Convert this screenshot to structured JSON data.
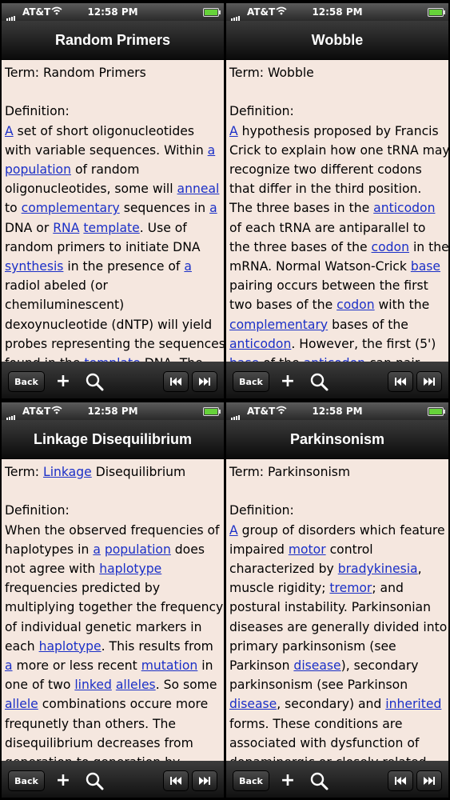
{
  "statusbar": {
    "carrier": "AT&T",
    "time": "12:58 PM"
  },
  "toolbar": {
    "back_label": "Back",
    "add_label": "+"
  },
  "colors": {
    "link": "#1a2fc7",
    "page_bg": "#f5e7df",
    "battery": "#66d23a"
  },
  "icons": [
    "signal-icon",
    "wifi-icon",
    "battery-icon",
    "plus-icon",
    "search-icon",
    "previous-icon",
    "next-icon"
  ],
  "panels": [
    {
      "title": "Random Primers",
      "lines": [
        [
          {
            "t": "Term: Random Primers"
          }
        ],
        [
          {
            "t": ""
          }
        ],
        [
          {
            "t": "Definition:"
          }
        ],
        [
          {
            "t": "A",
            "link": true
          },
          {
            "t": " set of short oligonucleotides"
          }
        ],
        [
          {
            "t": "with variable sequences. Within "
          },
          {
            "t": "a",
            "link": true
          }
        ],
        [
          {
            "t": "population",
            "link": true
          },
          {
            "t": " of random"
          }
        ],
        [
          {
            "t": "oligonucleotides, some will "
          },
          {
            "t": "anneal",
            "link": true
          }
        ],
        [
          {
            "t": "to "
          },
          {
            "t": "complementary",
            "link": true
          },
          {
            "t": " sequences in "
          },
          {
            "t": "a",
            "link": true
          }
        ],
        [
          {
            "t": "DNA or "
          },
          {
            "t": "RNA",
            "link": true
          },
          {
            "t": " "
          },
          {
            "t": "template",
            "link": true
          },
          {
            "t": ". Use of"
          }
        ],
        [
          {
            "t": "random primers to initiate DNA"
          }
        ],
        [
          {
            "t": "synthesis",
            "link": true
          },
          {
            "t": " in the presence of "
          },
          {
            "t": "a",
            "link": true
          }
        ],
        [
          {
            "t": "radiol abeled (or"
          }
        ],
        [
          {
            "t": "chemiluminescent)"
          }
        ],
        [
          {
            "t": "dexoynucleotide (dNTP) will yield"
          }
        ],
        [
          {
            "t": "probes representing the sequences"
          }
        ],
        [
          {
            "t": "found in the "
          },
          {
            "t": "template",
            "link": true
          },
          {
            "t": " DNA. The"
          }
        ]
      ]
    },
    {
      "title": "Wobble",
      "lines": [
        [
          {
            "t": "Term: Wobble"
          }
        ],
        [
          {
            "t": ""
          }
        ],
        [
          {
            "t": "Definition:"
          }
        ],
        [
          {
            "t": "A",
            "link": true
          },
          {
            "t": " hypothesis proposed by Francis"
          }
        ],
        [
          {
            "t": "Crick to explain how one tRNA may"
          }
        ],
        [
          {
            "t": "recognize two different codons"
          }
        ],
        [
          {
            "t": "that differ in the third position."
          }
        ],
        [
          {
            "t": "The three bases in the "
          },
          {
            "t": "anticodon",
            "link": true
          }
        ],
        [
          {
            "t": "of each tRNA are antiparallel to"
          }
        ],
        [
          {
            "t": "the three bases of the "
          },
          {
            "t": "codon",
            "link": true
          },
          {
            "t": " in the"
          }
        ],
        [
          {
            "t": "mRNA. Normal Watson-Crick "
          },
          {
            "t": "base",
            "link": true
          }
        ],
        [
          {
            "t": "pairing occurs between the first"
          }
        ],
        [
          {
            "t": "two bases of the "
          },
          {
            "t": "codon",
            "link": true
          },
          {
            "t": " with the"
          }
        ],
        [
          {
            "t": "complementary",
            "link": true
          },
          {
            "t": " bases of the"
          }
        ],
        [
          {
            "t": "anticodon",
            "link": true
          },
          {
            "t": ". However, the first (5')"
          }
        ],
        [
          {
            "t": "base",
            "link": true
          },
          {
            "t": " of the "
          },
          {
            "t": "anticodon",
            "link": true
          },
          {
            "t": " can pair"
          }
        ]
      ]
    },
    {
      "title": "Linkage Disequilibrium",
      "lines": [
        [
          {
            "t": "Term: "
          },
          {
            "t": "Linkage",
            "link": true
          },
          {
            "t": " Disequilibrium"
          }
        ],
        [
          {
            "t": ""
          }
        ],
        [
          {
            "t": "Definition:"
          }
        ],
        [
          {
            "t": "When the observed frequencies of"
          }
        ],
        [
          {
            "t": "haplotypes in "
          },
          {
            "t": "a",
            "link": true
          },
          {
            "t": " "
          },
          {
            "t": "population",
            "link": true
          },
          {
            "t": " does"
          }
        ],
        [
          {
            "t": "not agree with "
          },
          {
            "t": "haplotype",
            "link": true
          }
        ],
        [
          {
            "t": "frequencies predicted by"
          }
        ],
        [
          {
            "t": "multiplying together the frequency"
          }
        ],
        [
          {
            "t": "of individual genetic markers in"
          }
        ],
        [
          {
            "t": "each "
          },
          {
            "t": "haplotype",
            "link": true
          },
          {
            "t": ". This results from"
          }
        ],
        [
          {
            "t": "a",
            "link": true
          },
          {
            "t": " more or less recent "
          },
          {
            "t": "mutation",
            "link": true
          },
          {
            "t": " in"
          }
        ],
        [
          {
            "t": "one of two "
          },
          {
            "t": "linked",
            "link": true
          },
          {
            "t": " "
          },
          {
            "t": "alleles",
            "link": true
          },
          {
            "t": ". So some"
          }
        ],
        [
          {
            "t": "allele",
            "link": true
          },
          {
            "t": " combinations occure more"
          }
        ],
        [
          {
            "t": "frequnetly than others. The"
          }
        ],
        [
          {
            "t": "disequilibrium decreases from"
          }
        ],
        [
          {
            "t": "generation to generation by"
          }
        ]
      ]
    },
    {
      "title": "Parkinsonism",
      "lines": [
        [
          {
            "t": "Term: Parkinsonism"
          }
        ],
        [
          {
            "t": ""
          }
        ],
        [
          {
            "t": "Definition:"
          }
        ],
        [
          {
            "t": "A",
            "link": true
          },
          {
            "t": " group of disorders which feature"
          }
        ],
        [
          {
            "t": "impaired "
          },
          {
            "t": "motor",
            "link": true
          },
          {
            "t": " control"
          }
        ],
        [
          {
            "t": "characterized by "
          },
          {
            "t": "bradykinesia",
            "link": true
          },
          {
            "t": ","
          }
        ],
        [
          {
            "t": "muscle rigidity; "
          },
          {
            "t": "tremor",
            "link": true
          },
          {
            "t": "; and"
          }
        ],
        [
          {
            "t": "postural instability. Parkinsonian"
          }
        ],
        [
          {
            "t": "diseases are generally divided into"
          }
        ],
        [
          {
            "t": "primary parkinsonism (see"
          }
        ],
        [
          {
            "t": "Parkinson "
          },
          {
            "t": "disease",
            "link": true
          },
          {
            "t": "), secondary"
          }
        ],
        [
          {
            "t": "parkinsonism (see Parkinson"
          }
        ],
        [
          {
            "t": "disease",
            "link": true
          },
          {
            "t": ", secondary) and "
          },
          {
            "t": "inherited",
            "link": true
          }
        ],
        [
          {
            "t": "forms. These conditions are"
          }
        ],
        [
          {
            "t": "associated with dysfunction of"
          }
        ],
        [
          {
            "t": "dopaminergic or closely related"
          }
        ]
      ]
    }
  ]
}
